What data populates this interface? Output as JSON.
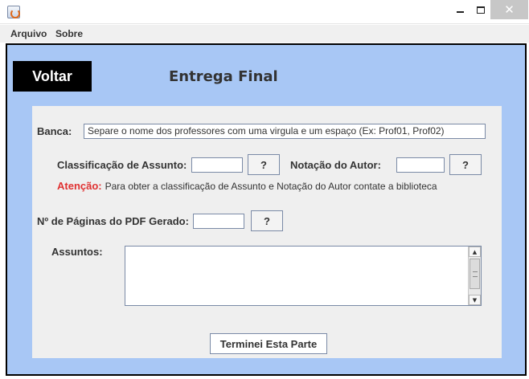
{
  "window": {
    "icon": "java-cup-icon",
    "controls": {
      "minimize": "minimize-icon",
      "maximize": "maximize-icon",
      "close_symbol": "✕"
    }
  },
  "menu": {
    "items": [
      "Arquivo",
      "Sobre"
    ]
  },
  "header": {
    "back_label": "Voltar",
    "title": "Entrega Final"
  },
  "form": {
    "banca": {
      "label": "Banca:",
      "value": "Separe o nome dos professores com uma virgula e um espaço (Ex: Prof01, Prof02)"
    },
    "classificacao": {
      "label": "Classificação de Assunto:",
      "value": "",
      "help_label": "?"
    },
    "notacao": {
      "label": "Notação do Autor:",
      "value": "",
      "help_label": "?"
    },
    "attention": {
      "label": "Atenção:",
      "text": "Para obter a classificação de Assunto e Notação do Autor contate a biblioteca"
    },
    "paginas": {
      "label": "Nº de Páginas do PDF Gerado:",
      "value": "",
      "help_label": "?"
    },
    "assuntos": {
      "label": "Assuntos:",
      "value": ""
    },
    "submit_label": "Terminei Esta Parte"
  },
  "colors": {
    "background": "#a8c7f5",
    "panel": "#efefef",
    "back_button": "#000000",
    "attention": "#e03131"
  }
}
